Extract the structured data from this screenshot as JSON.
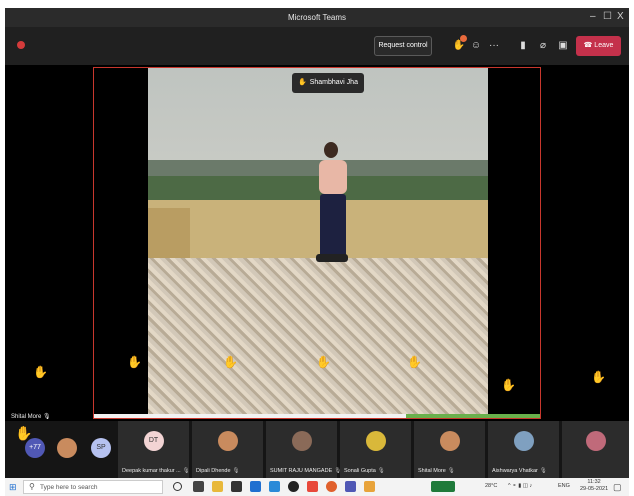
{
  "window": {
    "title": "Microsoft Teams",
    "controls": [
      "–",
      "☐",
      "X"
    ]
  },
  "toolbar": {
    "request_control": "Request control",
    "leave": "Leave",
    "more": "···"
  },
  "stage": {
    "presenter_name": "Shambhavi Jha",
    "local_name": "Shital More",
    "playback_progress": 0.7
  },
  "gallery": {
    "overflow_count": "+77",
    "sp_initials": "SP",
    "participants": [
      {
        "initials": "DT",
        "name": "Deepak kumar thakur ..."
      },
      {
        "initials": "",
        "name": "Dipali Dhende"
      },
      {
        "initials": "",
        "name": "SUMIT RAJU MANGADE"
      },
      {
        "initials": "",
        "name": "Sonali Gupta"
      },
      {
        "initials": "",
        "name": "Shital More"
      },
      {
        "initials": "",
        "name": "Aishwarya Vhatkar"
      },
      {
        "initials": "",
        "name": ""
      }
    ]
  },
  "taskbar": {
    "search_placeholder": "Type here to search",
    "weather": "28°C",
    "language": "ENG",
    "time": "11:32",
    "date": "29-05-2021"
  },
  "colors": {
    "leave": "#c4314b",
    "share_border": "#c8372d",
    "raised_hand": "#f5c33b"
  }
}
